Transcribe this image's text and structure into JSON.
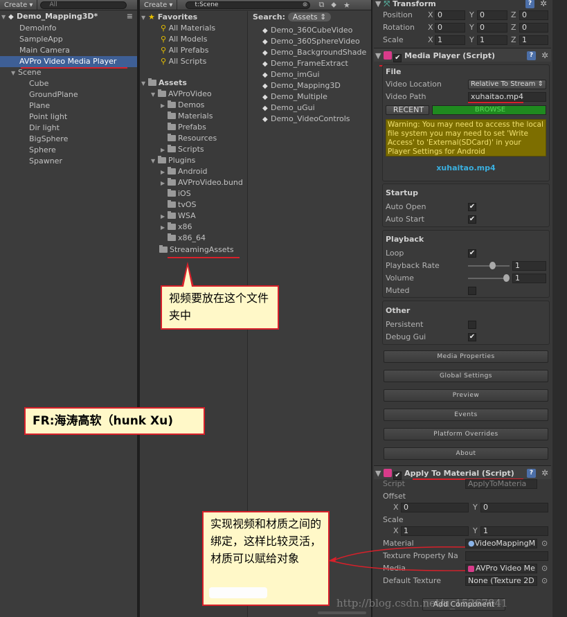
{
  "hierarchy": {
    "create": "Create ▾",
    "search": "All",
    "root": "Demo_Mapping3D*",
    "items": [
      "DemoInfo",
      "SampleApp",
      "Main Camera",
      "AVPro Video Media Player",
      "Scene",
      "Cube",
      "GroundPlane",
      "Plane",
      "Point light",
      "Dir light",
      "BigSphere",
      "Sphere",
      "Spawner"
    ]
  },
  "project": {
    "create": "Create ▾",
    "search": "t:Scene",
    "search_label": "Search:",
    "search_scope": "Assets ⇕",
    "favorites": "Favorites",
    "fav_items": [
      "All Materials",
      "All Models",
      "All Prefabs",
      "All Scripts"
    ],
    "assets": "Assets",
    "folders": [
      "AVProVideo",
      "Demos",
      "Materials",
      "Prefabs",
      "Resources",
      "Scripts",
      "Plugins",
      "Android",
      "AVProVideo.bund",
      "iOS",
      "tvOS",
      "WSA",
      "x86",
      "x86_64",
      "StreamingAssets"
    ],
    "scenes": [
      "Demo_360CubeVideo",
      "Demo_360SphereVideo",
      "Demo_BackgroundShade",
      "Demo_FrameExtract",
      "Demo_imGui",
      "Demo_Mapping3D",
      "Demo_Multiple",
      "Demo_uGui",
      "Demo_VideoControls"
    ]
  },
  "inspector": {
    "transform": "Transform",
    "position": "Position",
    "rotation": "Rotation",
    "scale": "Scale",
    "pos": [
      "0",
      "0",
      "0"
    ],
    "rot": [
      "0",
      "0",
      "0"
    ],
    "scl": [
      "1",
      "1",
      "1"
    ],
    "media_player": "Media Player (Script)",
    "file": "File",
    "video_location": "Video Location",
    "video_location_value": "Relative To Stream ⇕",
    "video_path": "Video Path",
    "video_path_value": "xuhaitao.mp4",
    "recent": "RECENT",
    "browse": "BROWSE",
    "warning": "Warning: You may need to access the local file system you may need to set 'Write Access' to 'External(SDCard)' in your Player Settings for Android",
    "filename": "xuhaitao.mp4",
    "startup": "Startup",
    "auto_open": "Auto Open",
    "auto_start": "Auto Start",
    "playback": "Playback",
    "loop": "Loop",
    "playback_rate": "Playback Rate",
    "rate_value": "1",
    "volume": "Volume",
    "volume_value": "1",
    "muted": "Muted",
    "other": "Other",
    "persistent": "Persistent",
    "debug_gui": "Debug Gui",
    "buttons": [
      "Media Properties",
      "Global Settings",
      "Preview",
      "Events",
      "Platform Overrides",
      "About"
    ],
    "apply": "Apply To Material (Script)",
    "script": "Script",
    "script_value": "ApplyToMateria",
    "offset": "Offset",
    "offset_x": "0",
    "offset_y": "0",
    "scale2": "Scale",
    "scale_x": "1",
    "scale_y": "1",
    "material": "Material",
    "material_value": "VideoMappingM",
    "texture_prop": "Texture Property Na",
    "media": "Media",
    "media_value": "AVPro Video Me",
    "default_texture": "Default Texture",
    "default_texture_value": "None (Texture 2D",
    "add_component": "Add Component",
    "watermark": "http://blog.csdn.net/u_15267841"
  },
  "callouts": {
    "folder": "视频要放在这个文件夹中",
    "author": "FR:海涛高软（hunk Xu)",
    "binding": "实现视频和材质之间的绑定，这样比较灵活，材质可以赋给对象"
  },
  "colors": {
    "selection": "#3e5f96",
    "browse": "#1f8a1f",
    "warning_bg": "#7d6e00",
    "callout_bg": "#fff8c8",
    "callout_border": "#d8202a"
  }
}
